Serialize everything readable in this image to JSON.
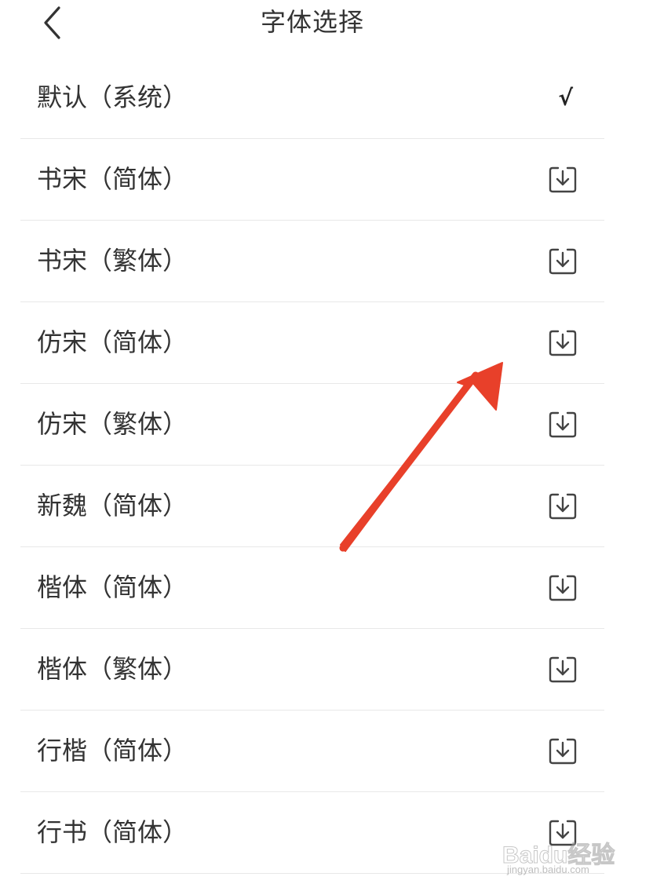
{
  "header": {
    "title": "字体选择"
  },
  "fonts": [
    {
      "label": "默认（系统）",
      "state": "selected",
      "selected_mark": "√"
    },
    {
      "label": "书宋（简体）",
      "state": "download"
    },
    {
      "label": "书宋（繁体）",
      "state": "download"
    },
    {
      "label": "仿宋（简体）",
      "state": "download"
    },
    {
      "label": "仿宋（繁体）",
      "state": "download"
    },
    {
      "label": "新魏（简体）",
      "state": "download"
    },
    {
      "label": "楷体（简体）",
      "state": "download"
    },
    {
      "label": "楷体（繁体）",
      "state": "download"
    },
    {
      "label": "行楷（简体）",
      "state": "download"
    },
    {
      "label": "行书（简体）",
      "state": "download"
    }
  ],
  "icons": {
    "back": "chevron-left-icon",
    "download": "download-box-icon",
    "selected": "check-icon"
  },
  "watermark": {
    "main": "Baidu经验",
    "sub": "jingyan.baidu.com"
  },
  "colors": {
    "text": "#333333",
    "divider": "#e8e8e8",
    "annotation_arrow": "#e8402a",
    "background": "#ffffff"
  }
}
